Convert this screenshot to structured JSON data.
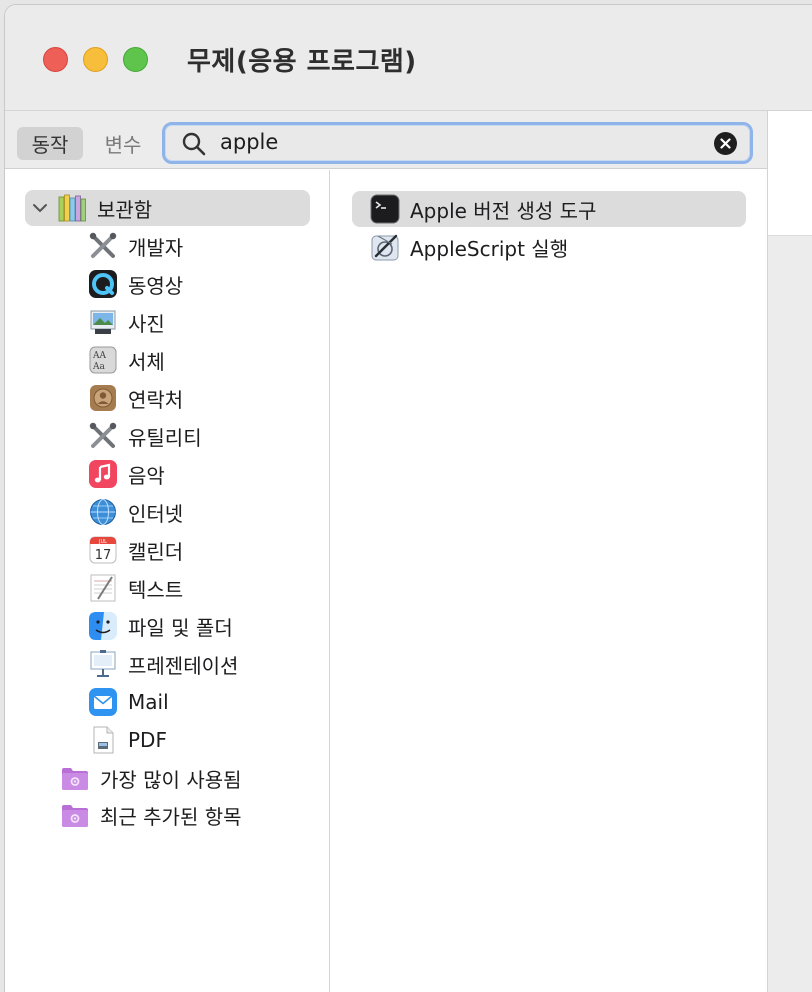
{
  "window": {
    "title": "무제(응용 프로그램)"
  },
  "toolbar": {
    "actions_tab": "동작",
    "variables_tab": "변수",
    "search": {
      "value": "apple"
    }
  },
  "library": {
    "root_label": "보관함",
    "categories": [
      {
        "label": "개발자",
        "icon": "developer-tools-icon"
      },
      {
        "label": "동영상",
        "icon": "quicktime-icon"
      },
      {
        "label": "사진",
        "icon": "photos-preview-icon"
      },
      {
        "label": "서체",
        "icon": "font-book-icon"
      },
      {
        "label": "연락처",
        "icon": "contacts-icon"
      },
      {
        "label": "유틸리티",
        "icon": "utilities-tools-icon"
      },
      {
        "label": "음악",
        "icon": "music-icon"
      },
      {
        "label": "인터넷",
        "icon": "internet-globe-icon"
      },
      {
        "label": "캘린더",
        "icon": "calendar-icon"
      },
      {
        "label": "텍스트",
        "icon": "textedit-icon"
      },
      {
        "label": "파일 및 폴더",
        "icon": "finder-icon"
      },
      {
        "label": "프레젠테이션",
        "icon": "keynote-icon"
      },
      {
        "label": "Mail",
        "icon": "mail-icon"
      },
      {
        "label": "PDF",
        "icon": "pdf-icon"
      }
    ],
    "smart_folders": [
      {
        "label": "가장 많이 사용됨",
        "icon": "smart-folder-icon"
      },
      {
        "label": "최근 추가된 항목",
        "icon": "smart-folder-icon"
      }
    ]
  },
  "actions": [
    {
      "label": "Apple 버전 생성 도구",
      "icon": "terminal-icon"
    },
    {
      "label": "AppleScript 실행",
      "icon": "script-editor-icon"
    }
  ],
  "calendar_icon": {
    "month": "JUL",
    "day": "17"
  }
}
